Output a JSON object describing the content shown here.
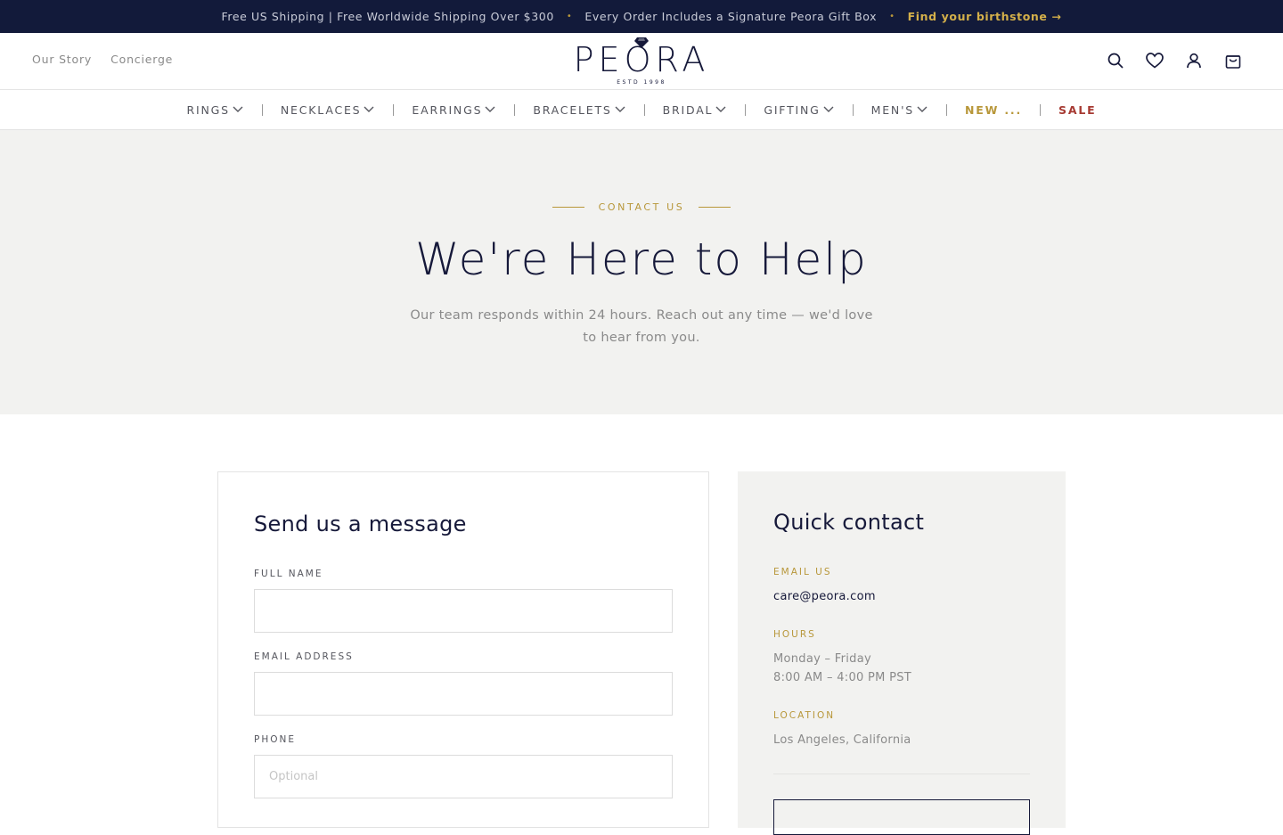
{
  "announcement": {
    "shipping": "Free US Shipping | Free Worldwide Shipping Over $300",
    "gift_box": "Every Order Includes a Signature Peora Gift Box",
    "birthstone_link": "Find your birthstone →",
    "separator": "•"
  },
  "header": {
    "left_links": [
      "Our Story",
      "Concierge"
    ],
    "logo_text": "PEORA",
    "logo_est": "ESTD 1998",
    "icons": [
      "search-icon",
      "heart-icon",
      "user-icon",
      "bag-icon"
    ]
  },
  "nav": {
    "items": [
      {
        "label": "RINGS",
        "dropdown": true
      },
      {
        "label": "NECKLACES",
        "dropdown": true
      },
      {
        "label": "EARRINGS",
        "dropdown": true
      },
      {
        "label": "BRACELETS",
        "dropdown": true
      },
      {
        "label": "BRIDAL",
        "dropdown": true
      },
      {
        "label": "GIFTING",
        "dropdown": true
      },
      {
        "label": "MEN'S",
        "dropdown": true
      },
      {
        "label": "NEW ...",
        "dropdown": false
      },
      {
        "label": "SALE",
        "dropdown": false
      }
    ]
  },
  "hero": {
    "eyebrow": "CONTACT US",
    "title": "We're Here to Help",
    "subtitle": "Our team responds within 24 hours. Reach out any time — we'd love to hear from you."
  },
  "form": {
    "title": "Send us a message",
    "full_name_label": "FULL NAME",
    "full_name_value": "",
    "email_label": "EMAIL ADDRESS",
    "email_value": "",
    "phone_label": "PHONE",
    "phone_placeholder": "Optional"
  },
  "quick_contact": {
    "title": "Quick contact",
    "email_label": "EMAIL US",
    "email_value": "care@peora.com",
    "hours_label": "HOURS",
    "hours_days": "Monday – Friday",
    "hours_time": "8:00 AM – 4:00 PM PST",
    "location_label": "LOCATION",
    "location_value": "Los Angeles, California"
  },
  "colors": {
    "navy": "#121a3a",
    "gold": "#b8973a",
    "sale_red": "#a63a32",
    "hero_bg": "#f2f2f0"
  }
}
